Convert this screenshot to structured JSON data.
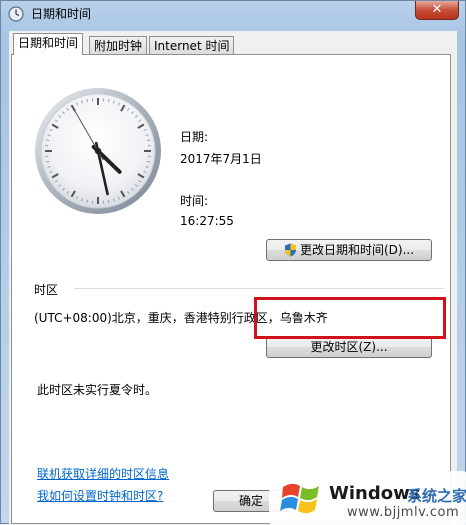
{
  "window": {
    "title": "日期和时间",
    "close_label": "✕"
  },
  "tabs": [
    {
      "label": "日期和时间",
      "active": true
    },
    {
      "label": "附加时钟",
      "active": false
    },
    {
      "label": "Internet 时间",
      "active": false
    }
  ],
  "clock": {
    "hour": 16,
    "minute": 27,
    "second": 55
  },
  "date": {
    "label": "日期:",
    "value": "2017年7月1日"
  },
  "time": {
    "label": "时间:",
    "value": "16:27:55"
  },
  "buttons": {
    "change_datetime": "更改日期和时间(D)...",
    "change_timezone": "更改时区(Z)...",
    "ok": "确定"
  },
  "timezone": {
    "section_label": "时区",
    "value": "(UTC+08:00)北京，重庆，香港特别行政区，乌鲁木齐",
    "dst_note": "此时区未实行夏令时。"
  },
  "links": {
    "online_info": "联机获取详细的时区信息",
    "how_to_set": "我如何设置时钟和时区?"
  },
  "watermark": {
    "brand": "Windows",
    "brand_cn": "系统之家",
    "url": "www.bjjmlv.com"
  },
  "colors": {
    "highlight_border": "#d0121a",
    "link": "#0066cc",
    "shield_blue": "#2b6cc4",
    "shield_yellow": "#f0c419"
  }
}
